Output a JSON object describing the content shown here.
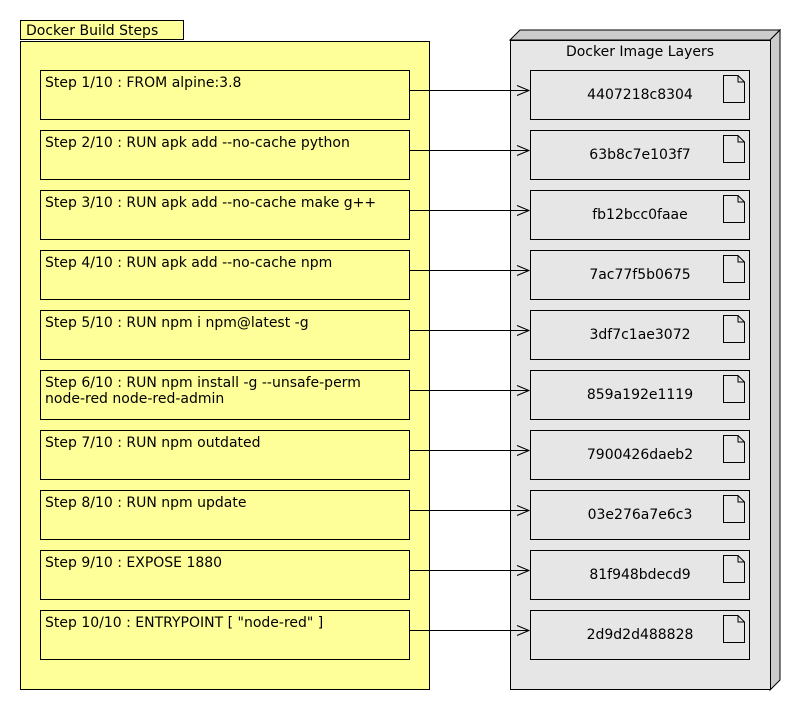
{
  "build_steps": {
    "title": "Docker Build Steps",
    "steps": [
      "Step 1/10 : FROM alpine:3.8",
      "Step 2/10 : RUN apk add --no-cache python",
      "Step 3/10 : RUN apk add --no-cache make g++",
      "Step 4/10 : RUN apk add --no-cache npm",
      "Step 5/10 : RUN npm i npm@latest -g",
      "Step 6/10 : RUN npm install -g --unsafe-perm\nnode-red node-red-admin",
      "Step 7/10 : RUN npm outdated",
      "Step 8/10 : RUN npm update",
      "Step 9/10 : EXPOSE 1880",
      "Step 10/10 : ENTRYPOINT [ \"node-red\" ]"
    ]
  },
  "image_layers": {
    "title": "Docker Image Layers",
    "layers": [
      "4407218c8304",
      "63b8c7e103f7",
      "fb12bcc0faae",
      "7ac77f5b0675",
      "3df7c1ae3072",
      "859a192e1119",
      "7900426daeb2",
      "03e276a7e6c3",
      "81f948bdecd9",
      "2d9d2d488828"
    ]
  },
  "colors": {
    "package_fill": "#ffff99",
    "node_fill": "#e6e6e6",
    "node_side": "#cccccc",
    "line": "#000000"
  }
}
